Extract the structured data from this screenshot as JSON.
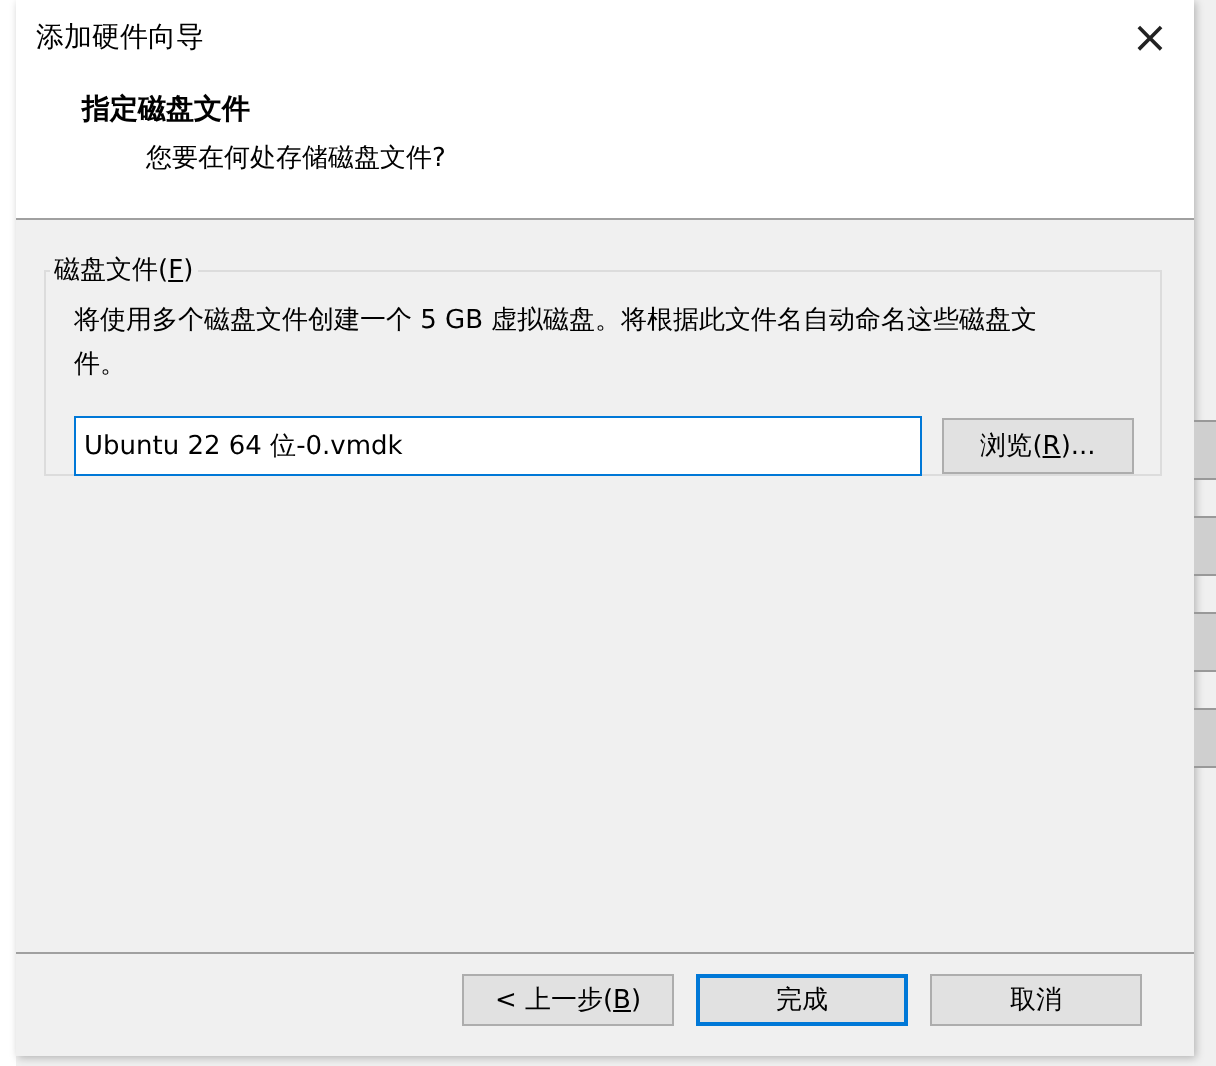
{
  "window": {
    "title": "添加硬件向导",
    "close": "×"
  },
  "header": {
    "title": "指定磁盘文件",
    "subtitle": "您要在何处存储磁盘文件?"
  },
  "group": {
    "label": {
      "before": "磁盘文件(",
      "key": "F",
      "after": ")"
    },
    "description": "将使用多个磁盘文件创建一个 5 GB 虚拟磁盘。将根据此文件名自动命名这些磁盘文件。",
    "file_field": {
      "value": "Ubuntu 22 64 位-0.vmdk",
      "focused": true
    },
    "browse_button": {
      "before": "浏览(",
      "key": "R",
      "after": ")..."
    }
  },
  "buttons": [
    {
      "before": "< 上一步(",
      "key": "B",
      "after": ")",
      "default": false
    },
    {
      "before": "完成",
      "default": true
    },
    {
      "before": "取消",
      "default": false
    }
  ]
}
